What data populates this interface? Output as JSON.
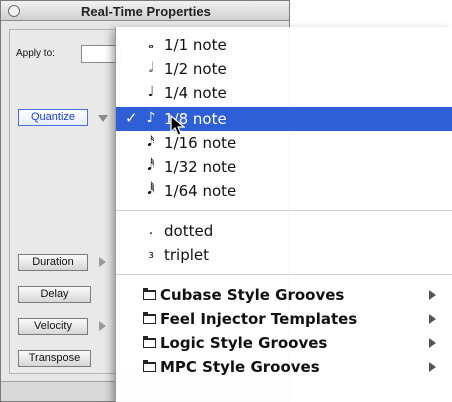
{
  "window": {
    "title": "Real-Time Properties",
    "apply_label": "Apply to:",
    "buttons": {
      "quantize": "Quantize",
      "duration": "Duration",
      "delay": "Delay",
      "velocity": "Velocity",
      "transpose": "Transpose"
    }
  },
  "menu": {
    "check_mark": "✓",
    "note_values": [
      {
        "glyph": "𝅝",
        "label": "1/1 note",
        "selected": false
      },
      {
        "glyph": "𝅗𝅥",
        "label": "1/2 note",
        "selected": false
      },
      {
        "glyph": "♩",
        "label": "1/4 note",
        "selected": false
      },
      {
        "glyph": "♪",
        "label": "1/8 note",
        "selected": true
      },
      {
        "glyph": "𝅘𝅥𝅯",
        "label": "1/16 note",
        "selected": false
      },
      {
        "glyph": "𝅘𝅥𝅰",
        "label": "1/32 note",
        "selected": false
      },
      {
        "glyph": "𝅘𝅥𝅱",
        "label": "1/64 note",
        "selected": false
      }
    ],
    "modifiers": [
      {
        "glyph": ".",
        "label": "dotted"
      },
      {
        "glyph": "₃",
        "label": "triplet"
      }
    ],
    "groove_folders": [
      {
        "label": "Cubase Style Grooves"
      },
      {
        "label": "Feel Injector Templates"
      },
      {
        "label": "Logic Style Grooves"
      },
      {
        "label": "MPC Style Grooves"
      }
    ]
  },
  "colors": {
    "selection": "#2e5fd6",
    "quantize_text": "#1a3fd1"
  }
}
